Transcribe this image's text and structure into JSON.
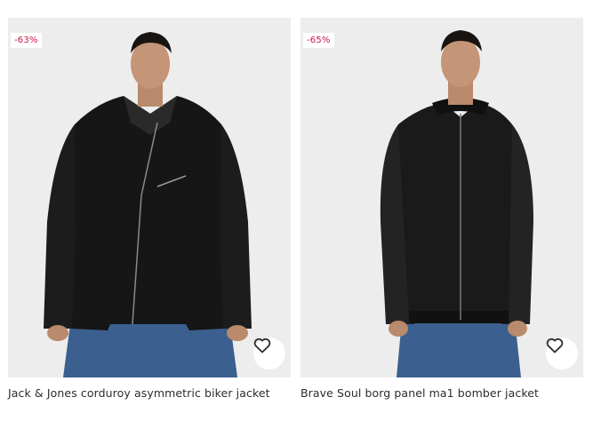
{
  "products": [
    {
      "discount": "-63%",
      "title": "Jack & Jones corduroy asymmetric biker jacket",
      "wishlist_icon": "heart-icon"
    },
    {
      "discount": "-65%",
      "title": "Brave Soul borg panel ma1 bomber jacket",
      "wishlist_icon": "heart-icon"
    }
  ],
  "colors": {
    "badge_text": "#d01345",
    "photo_bg": "#ededed",
    "title_text": "#2d2d2d"
  }
}
